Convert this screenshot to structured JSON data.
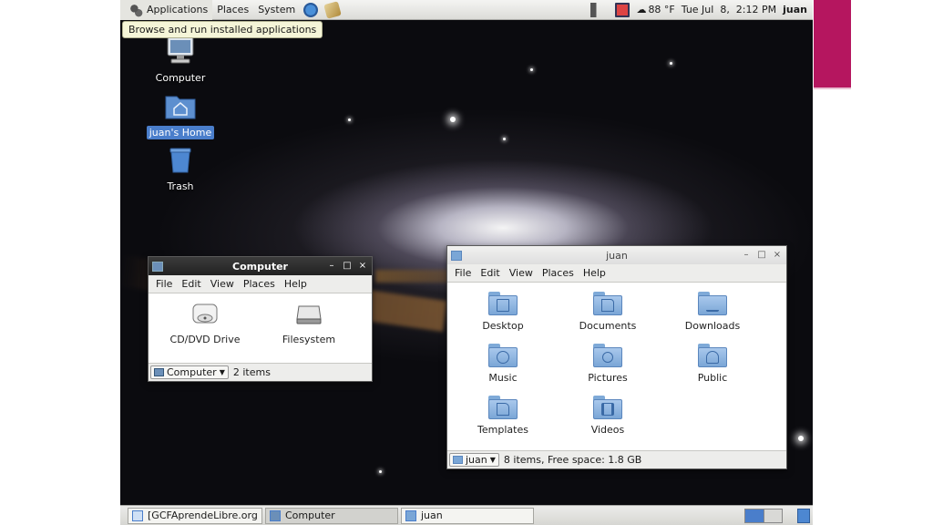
{
  "top_panel": {
    "menus": [
      "Applications",
      "Places",
      "System"
    ],
    "weather": "88 °F",
    "clock": "Tue Jul  8,  2:12 PM",
    "user": "juan"
  },
  "tooltip": "Browse and run installed applications",
  "desktop_icons": [
    {
      "label": "Computer",
      "icon": "computer-icon"
    },
    {
      "label": "juan's Home",
      "icon": "home-folder-icon",
      "selected": true
    },
    {
      "label": "Trash",
      "icon": "trash-icon"
    }
  ],
  "computer_window": {
    "title": "Computer",
    "menu": [
      "File",
      "Edit",
      "View",
      "Places",
      "Help"
    ],
    "items": [
      {
        "label": "CD/DVD Drive",
        "icon": "cd-drive-icon"
      },
      {
        "label": "Filesystem",
        "icon": "harddisk-icon"
      }
    ],
    "location": "Computer",
    "status": "2 items"
  },
  "home_window": {
    "title": "juan",
    "menu": [
      "File",
      "Edit",
      "View",
      "Places",
      "Help"
    ],
    "items": [
      {
        "label": "Desktop",
        "icon": "desktop-folder-icon"
      },
      {
        "label": "Documents",
        "icon": "documents-folder-icon"
      },
      {
        "label": "Downloads",
        "icon": "downloads-folder-icon"
      },
      {
        "label": "Music",
        "icon": "music-folder-icon"
      },
      {
        "label": "Pictures",
        "icon": "pictures-folder-icon"
      },
      {
        "label": "Public",
        "icon": "public-folder-icon"
      },
      {
        "label": "Templates",
        "icon": "templates-folder-icon"
      },
      {
        "label": "Videos",
        "icon": "videos-folder-icon"
      }
    ],
    "location": "juan",
    "status": "8 items, Free space: 1.8 GB"
  },
  "window_controls": {
    "minimize": "–",
    "maximize": "□",
    "close": "×"
  },
  "taskbar": {
    "tasks": [
      "[GCFAprendeLibre.org ...",
      "Computer",
      "juan"
    ]
  },
  "colors": {
    "accent_bar": "#b5165f",
    "selection": "#4a7ecb",
    "folder": "#7aa6d6"
  }
}
